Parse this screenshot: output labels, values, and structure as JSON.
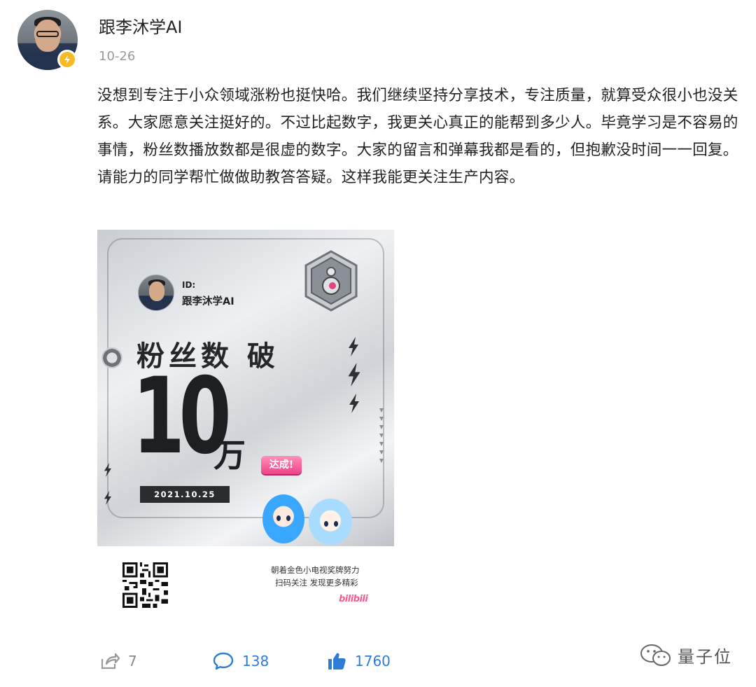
{
  "post": {
    "author": "跟李沐学AI",
    "date": "10-26",
    "text": "没想到专注于小众领域涨粉也挺快哈。我们继续坚持分享技术，专注质量，就算受众很小也没关系。大家愿意关注挺好的。不过比起数字，我更关心真正的能帮到多少人。毕竟学习是不容易的事情，粉丝数播放数都是很虚的数字。大家的留言和弹幕我都是看的，但抱歉没时间一一回复。请能力的同学帮忙做做助教答答疑。这样我能更关注生产内容。"
  },
  "poster": {
    "id_label": "ID:",
    "id_name": "跟李沐学AI",
    "headline": "粉丝数 破",
    "number": "10",
    "unit": "万",
    "reached": "达成!",
    "date": "2021.10.25",
    "caption_line1": "朝着金色小电视奖牌努力",
    "caption_line2": "扫码关注 发现更多精彩",
    "brand": "bilibili"
  },
  "actions": {
    "share_count": "7",
    "comment_count": "138",
    "like_count": "1760"
  },
  "watermark": {
    "text": "量子位"
  },
  "colors": {
    "accent": "#2d7cd6",
    "badge": "#f7b924",
    "bilibili_pink": "#f25d8e"
  }
}
